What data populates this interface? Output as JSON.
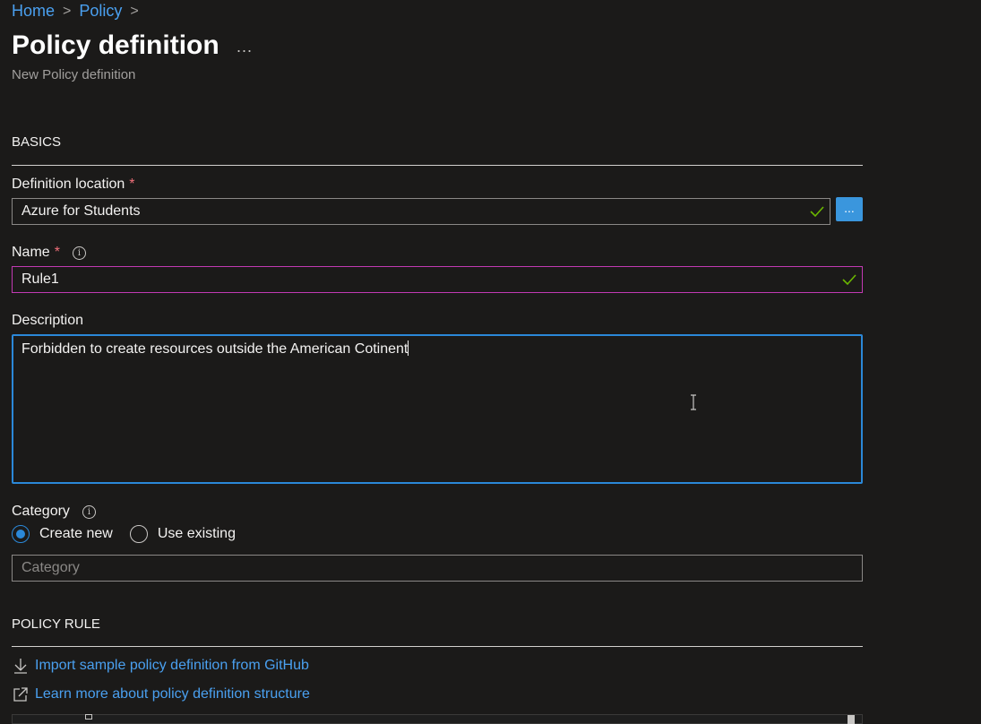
{
  "breadcrumb": {
    "items": [
      "Home",
      "Policy"
    ],
    "separator": ">"
  },
  "page": {
    "title": "Policy definition",
    "more_label": "...",
    "subtitle": "New Policy definition"
  },
  "basics": {
    "heading": "BASICS",
    "definition_location": {
      "label": "Definition location",
      "required_mark": "*",
      "value": "Azure for Students",
      "browse_label": "..."
    },
    "name": {
      "label": "Name",
      "required_mark": "*",
      "value": "Rule1"
    },
    "description": {
      "label": "Description",
      "value": "Forbidden to create resources outside the American Cotinent"
    },
    "category": {
      "label": "Category",
      "options": [
        "Create new",
        "Use existing"
      ],
      "selected": "Create new",
      "placeholder": "Category"
    }
  },
  "policy_rule": {
    "heading": "POLICY RULE",
    "import_link": "Import sample policy definition from GitHub",
    "learn_link": "Learn more about policy definition structure"
  },
  "colors": {
    "background": "#1b1a19",
    "link": "#4aa0f0",
    "accent": "#2b88d8",
    "valid_check": "#6bb700",
    "required": "#f1707b",
    "name_border": "#c239b3"
  },
  "icons": {
    "info": "info-icon",
    "valid": "check-icon",
    "import": "download-icon",
    "external": "open-external-icon",
    "text_cursor": "ibeam-cursor-icon"
  }
}
